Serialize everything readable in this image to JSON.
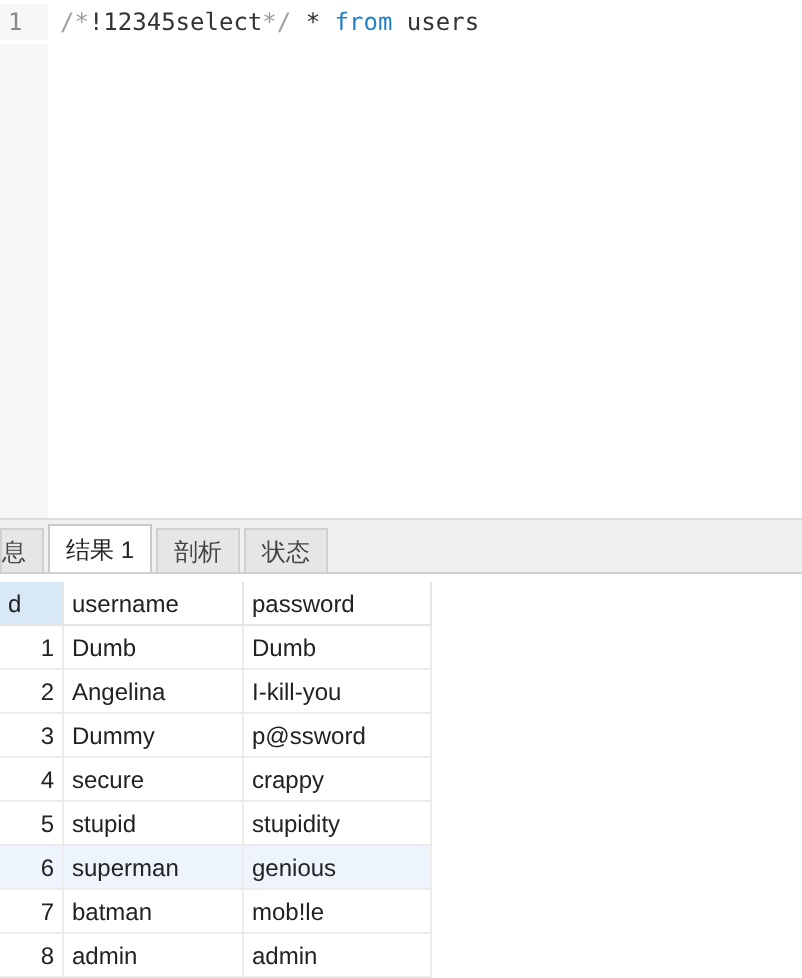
{
  "editor": {
    "lines": [
      {
        "number": "1",
        "tokens": [
          {
            "kind": "comment",
            "text": "/*"
          },
          {
            "kind": "plain",
            "text": "!12345select"
          },
          {
            "kind": "comment",
            "text": "*/"
          },
          {
            "kind": "plain",
            "text": " * "
          },
          {
            "kind": "keyword",
            "text": "from"
          },
          {
            "kind": "plain",
            "text": " users"
          }
        ]
      }
    ]
  },
  "tabs": [
    {
      "label": "息",
      "selected": false
    },
    {
      "label": "结果 1",
      "selected": true
    },
    {
      "label": "剖析",
      "selected": false
    },
    {
      "label": "状态",
      "selected": false
    }
  ],
  "table": {
    "columns": [
      {
        "label": "d",
        "selected": true
      },
      {
        "label": "username",
        "selected": false
      },
      {
        "label": "password",
        "selected": false
      }
    ],
    "rows": [
      {
        "cells": [
          "1",
          "Dumb",
          "Dumb"
        ],
        "selected": false
      },
      {
        "cells": [
          "2",
          "Angelina",
          "I-kill-you"
        ],
        "selected": false
      },
      {
        "cells": [
          "3",
          "Dummy",
          "p@ssword"
        ],
        "selected": false
      },
      {
        "cells": [
          "4",
          "secure",
          "crappy"
        ],
        "selected": false
      },
      {
        "cells": [
          "5",
          "stupid",
          "stupidity"
        ],
        "selected": false
      },
      {
        "cells": [
          "6",
          "superman",
          "genious"
        ],
        "selected": true
      },
      {
        "cells": [
          "7",
          "batman",
          "mob!le"
        ],
        "selected": false
      },
      {
        "cells": [
          "8",
          "admin",
          "admin"
        ],
        "selected": false
      }
    ]
  }
}
